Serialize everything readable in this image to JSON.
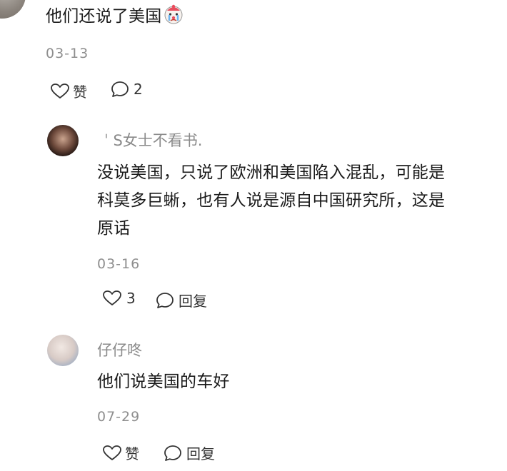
{
  "comment1": {
    "text": "他们还说了美国",
    "emoji_icon": "crying-clown-emoji",
    "date": "03-13",
    "like_label": "赞",
    "reply_count": "2"
  },
  "reply1": {
    "username": "ˈ S女士不看书.",
    "lines": [
      "没说美国，只说了欧洲和美国陷入混乱，可能是",
      "科莫多巨蜥，也有人说是源自中国研究所，这是",
      "原话"
    ],
    "date": "03-16",
    "like_count": "3",
    "reply_label": "回复"
  },
  "reply2": {
    "username": "仔仔咚",
    "text": "他们说美国的车好",
    "date": "07-29",
    "like_label": "赞",
    "reply_label": "回复"
  },
  "colors": {
    "text": "#1a1a1a",
    "muted": "#8e8e8e",
    "background": "#ffffff"
  }
}
